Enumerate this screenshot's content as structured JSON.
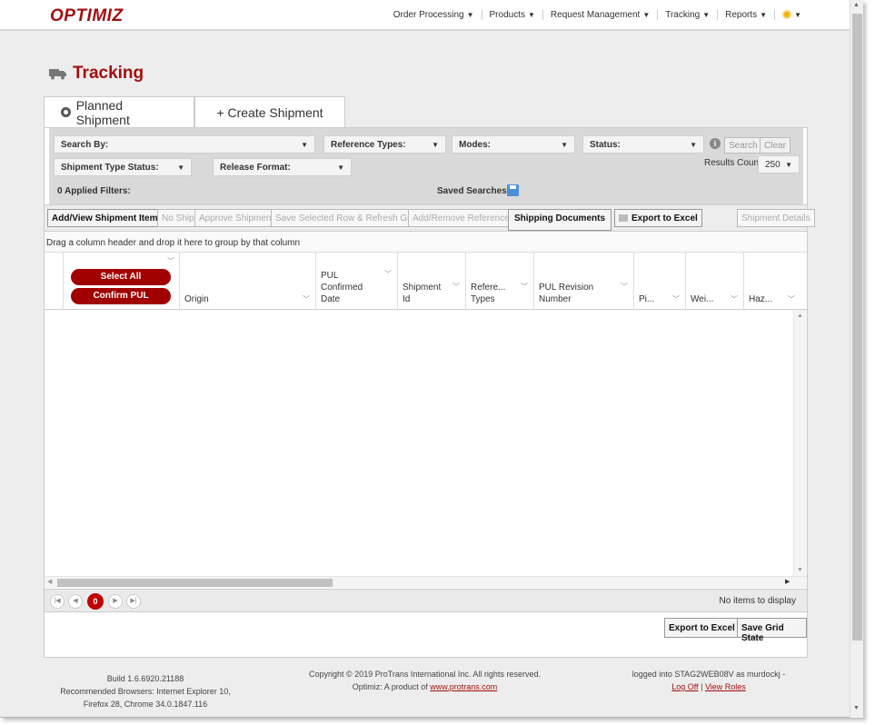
{
  "app": {
    "logo": "OPTIMIZ"
  },
  "topnav": {
    "items": [
      "Order Processing",
      "Products",
      "Request Management",
      "Tracking",
      "Reports"
    ],
    "caret": "▼"
  },
  "page": {
    "title": "Tracking"
  },
  "tabs": [
    {
      "label": "Planned Shipment",
      "active": true
    },
    {
      "label": "+ Create Shipment",
      "active": false
    }
  ],
  "filters": {
    "search_by": "Search By:",
    "reference_types": "Reference Types:",
    "modes": "Modes:",
    "status": "Status:",
    "search_btn": "Search",
    "clear_btn": "Clear",
    "shipment_type_status": "Shipment Type Status:",
    "release_format": "Release Format:",
    "results_count_label": "Results Count",
    "results_count_value": "250",
    "applied_filters": "0 Applied Filters:",
    "saved_searches": "Saved Searches:"
  },
  "toolbar": {
    "add_view": "Add/View Shipment Items",
    "no_ship": "No Ship",
    "approve": "Approve Shipment",
    "save_refresh": "Save Selected Row & Refresh Grid",
    "add_remove_refs": "Add/Remove References",
    "shipping_docs": "Shipping Documents",
    "export_excel": "Export to Excel",
    "shipment_details": "Shipment Details"
  },
  "grid": {
    "group_hint": "Drag a column header and drop it here to group by that column",
    "select_all": "Select All",
    "confirm_pul": "Confirm PUL",
    "columns": {
      "origin": "Origin",
      "pul_date_1": "PUL",
      "pul_date_2": "Confirmed",
      "pul_date_3": "Date",
      "shipment_1": "Shipment",
      "shipment_2": "Id",
      "ref_1": "Refere...",
      "ref_2": "Types",
      "pulrev_1": "PUL Revision",
      "pulrev_2": "Number",
      "pi": "Pi...",
      "wei": "Wei...",
      "haz": "Haz..."
    },
    "pager_current": "0",
    "no_items": "No items to display"
  },
  "bottom": {
    "export_excel": "Export to Excel",
    "save_grid": "Save Grid State"
  },
  "footer": {
    "build": "Build 1.6.6920.21188",
    "browsers_1": "Recommended Browsers: Internet Explorer 10,",
    "browsers_2": "Firefox 28, Chrome 34.0.1847.116",
    "copyright": "Copyright © 2019 ProTrans International Inc. All rights reserved.",
    "product_prefix": "Optimiz: A product of ",
    "product_link": "www.protrans.com",
    "logged_in": "logged into STAG2WEB08V as murdockj -",
    "log_off": "Log Off",
    "sep": "|",
    "view_roles": "View Roles"
  },
  "colors": {
    "brand": "#a01010",
    "button_red": "#a00000",
    "pager_active": "#c00000"
  }
}
